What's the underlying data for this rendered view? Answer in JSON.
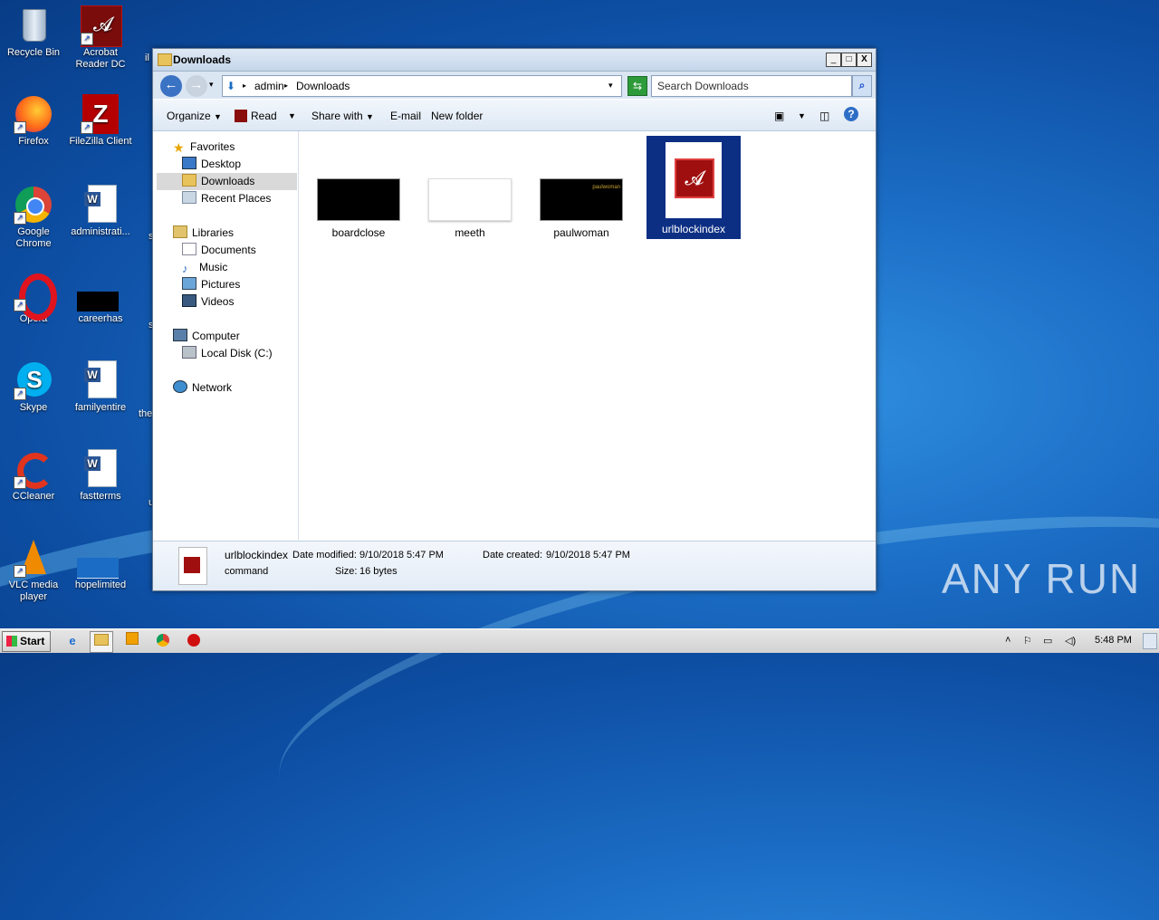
{
  "desktop": {
    "icons": [
      {
        "label": "Recycle Bin"
      },
      {
        "label": "Acrobat Reader DC"
      },
      {
        "label": "Firefox"
      },
      {
        "label": "FileZilla Client"
      },
      {
        "label": "Google Chrome"
      },
      {
        "label": "administrati..."
      },
      {
        "label": "Opera"
      },
      {
        "label": "careerhas"
      },
      {
        "label": "Skype"
      },
      {
        "label": "familyentire"
      },
      {
        "label": "CCleaner"
      },
      {
        "label": "fastterms"
      },
      {
        "label": "VLC media player"
      },
      {
        "label": "hopelimited"
      }
    ],
    "partial_labels": [
      "il",
      "s",
      "s",
      "the",
      "u"
    ],
    "watermark": "ANY RUN"
  },
  "window": {
    "title": "Downloads",
    "controls": {
      "minimize": "_",
      "maximize": "□",
      "close": "X"
    },
    "address": {
      "segments": [
        "admin",
        "Downloads"
      ]
    },
    "search": {
      "placeholder": "Search Downloads"
    },
    "toolbar": {
      "organize": "Organize",
      "read": "Read",
      "share_with": "Share with",
      "email": "E-mail",
      "new_folder": "New folder"
    },
    "nav": {
      "favorites": "Favorites",
      "desktop": "Desktop",
      "downloads": "Downloads",
      "recent_places": "Recent Places",
      "libraries": "Libraries",
      "documents": "Documents",
      "music": "Music",
      "pictures": "Pictures",
      "videos": "Videos",
      "computer": "Computer",
      "local_disk": "Local Disk (C:)",
      "network": "Network"
    },
    "files": [
      {
        "name": "boardclose"
      },
      {
        "name": "meeth"
      },
      {
        "name": "paulwoman",
        "thumb_text": "paulwoman"
      },
      {
        "name": "urlblockindex",
        "selected": true
      }
    ],
    "details": {
      "name": "urlblockindex",
      "type": "command",
      "date_modified_label": "Date modified:",
      "date_modified": "9/10/2018 5:47 PM",
      "date_created_label": "Date created:",
      "date_created": "9/10/2018 5:47 PM",
      "size_label": "Size:",
      "size": "16 bytes"
    }
  },
  "taskbar": {
    "start": "Start",
    "clock": "5:48 PM"
  }
}
